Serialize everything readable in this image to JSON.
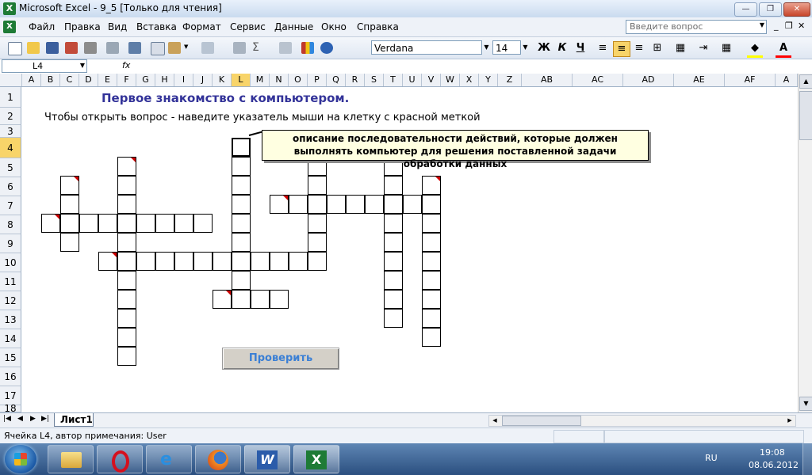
{
  "window": {
    "title": "Microsoft Excel - 9_5  [Только для чтения]",
    "help_placeholder": "Введите вопрос"
  },
  "menu": [
    {
      "label": "Файл"
    },
    {
      "label": "Правка"
    },
    {
      "label": "Вид"
    },
    {
      "label": "Вставка"
    },
    {
      "label": "Формат"
    },
    {
      "label": "Сервис"
    },
    {
      "label": "Данные"
    },
    {
      "label": "Окно"
    },
    {
      "label": "Справка"
    }
  ],
  "toolbar": {
    "font_name": "Verdana",
    "font_size": "14",
    "bold_label": "Ж",
    "italic_label": "К",
    "underline_label": "Ч",
    "sigma_label": "Σ"
  },
  "formula_bar": {
    "name_box": "L4",
    "fx_label": "fx",
    "value": ""
  },
  "columns": [
    "A",
    "B",
    "C",
    "D",
    "E",
    "F",
    "G",
    "H",
    "I",
    "J",
    "K",
    "L",
    "M",
    "N",
    "O",
    "P",
    "Q",
    "R",
    "S",
    "T",
    "U",
    "V",
    "W",
    "X",
    "Y",
    "Z",
    "AB",
    "AC",
    "AD",
    "AE",
    "AF",
    "A"
  ],
  "rows": [
    "1",
    "2",
    "3",
    "4",
    "5",
    "6",
    "7",
    "8",
    "9",
    "10",
    "11",
    "12",
    "13",
    "14",
    "15",
    "16",
    "17",
    "18"
  ],
  "sheet": {
    "heading": "Первое знакомство с компьютером.",
    "instruction": "Чтобы открыть вопрос - наведите указатель мыши на клетку с красной меткой",
    "comment": "описание последовательности действий, которые должен выполнять компьютер для решения поставленной задачи обработки данных",
    "check_button": "Проверить"
  },
  "sheet_tabs": [
    {
      "label": "Лист1"
    }
  ],
  "status": {
    "text": "Ячейка L4, автор примечания: User"
  },
  "taskbar": {
    "language": "RU",
    "time": "19:08",
    "date": "08.06.2012",
    "apps": [
      {
        "name": "explorer"
      },
      {
        "name": "opera"
      },
      {
        "name": "internet-explorer"
      },
      {
        "name": "firefox"
      },
      {
        "name": "word"
      },
      {
        "name": "excel"
      }
    ]
  },
  "colors": {
    "heading": "#333399",
    "comment_bg": "#ffffe1",
    "button_text": "#3a7fd5",
    "mark": "#cc0000",
    "selected_header": "#f8d469"
  }
}
